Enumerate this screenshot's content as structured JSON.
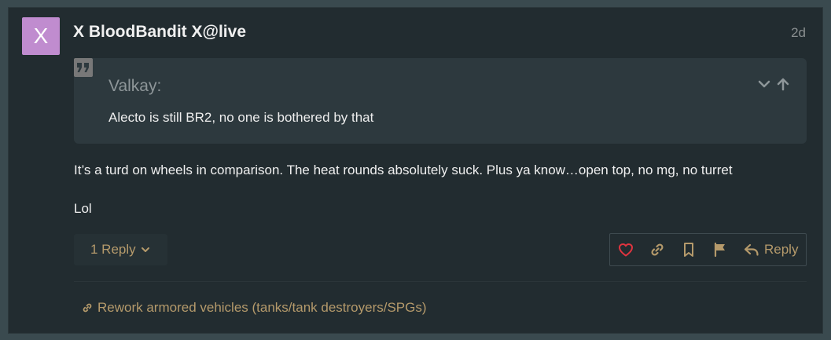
{
  "post": {
    "avatar_letter": "X",
    "username": "X BloodBandit X@live",
    "timestamp": "2d",
    "quote": {
      "author": "Valkay:",
      "text": "Alecto is still BR2, no one is bothered by that"
    },
    "body": [
      "It’s a turd on wheels in comparison. The heat rounds absolutely suck. Plus ya know…open top, no mg, no turret",
      "Lol"
    ],
    "replies_label": "1 Reply",
    "actions": {
      "reply_label": "Reply"
    },
    "topic_link": "Rework armored vehicles (tanks/tank destroyers/SPGs)"
  },
  "colors": {
    "background": "#222c30",
    "accent": "#b59a6b",
    "like": "#e0343f",
    "avatar": "#c08ccf"
  },
  "icons": [
    "quote-icon",
    "chevron-down-icon",
    "arrow-up-icon",
    "heart-icon",
    "link-icon",
    "bookmark-icon",
    "flag-icon",
    "reply-icon"
  ]
}
